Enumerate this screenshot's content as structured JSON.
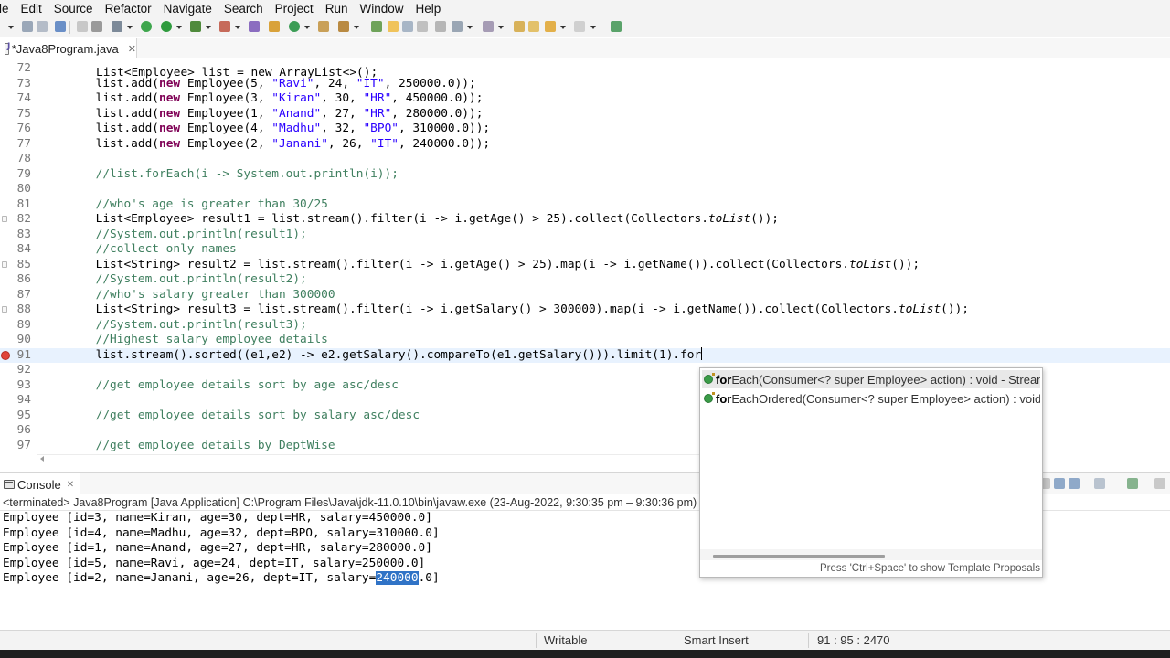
{
  "menu": [
    "le",
    "Edit",
    "Source",
    "Refactor",
    "Navigate",
    "Search",
    "Project",
    "Run",
    "Window",
    "Help"
  ],
  "editor": {
    "tab_title": "*Java8Program.java",
    "tab_close": "✕",
    "top_partial_text": "List<Employee> list = new ArrayList<>();",
    "lines": [
      {
        "num": "72",
        "text": ""
      },
      {
        "num": "73",
        "text": "        list.add(new Employee(5, \"Ravi\", 24, \"IT\", 250000.0));"
      },
      {
        "num": "74",
        "text": "        list.add(new Employee(3, \"Kiran\", 30, \"HR\", 450000.0));"
      },
      {
        "num": "75",
        "text": "        list.add(new Employee(1, \"Anand\", 27, \"HR\", 280000.0));"
      },
      {
        "num": "76",
        "text": "        list.add(new Employee(4, \"Madhu\", 32, \"BPO\", 310000.0));"
      },
      {
        "num": "77",
        "text": "        list.add(new Employee(2, \"Janani\", 26, \"IT\", 240000.0));"
      },
      {
        "num": "78",
        "text": ""
      },
      {
        "num": "79",
        "text": "        //list.forEach(i -> System.out.println(i));"
      },
      {
        "num": "80",
        "text": ""
      },
      {
        "num": "81",
        "text": "        //who's age is greater than 30/25"
      },
      {
        "num": "82",
        "text": "        List<Employee> result1 = list.stream().filter(i -> i.getAge() > 25).collect(Collectors.toList());"
      },
      {
        "num": "83",
        "text": "        //System.out.println(result1);"
      },
      {
        "num": "84",
        "text": "        //collect only names"
      },
      {
        "num": "85",
        "text": "        List<String> result2 = list.stream().filter(i -> i.getAge() > 25).map(i -> i.getName()).collect(Collectors.toList());"
      },
      {
        "num": "86",
        "text": "        //System.out.println(result2);"
      },
      {
        "num": "87",
        "text": "        //who's salary greater than 300000"
      },
      {
        "num": "88",
        "text": "        List<String> result3 = list.stream().filter(i -> i.getSalary() > 300000).map(i -> i.getName()).collect(Collectors.toList());"
      },
      {
        "num": "89",
        "text": "        //System.out.println(result3);"
      },
      {
        "num": "90",
        "text": "        //Highest salary employee details"
      },
      {
        "num": "91",
        "text": "        list.stream().sorted((e1,e2) -> e2.getSalary().compareTo(e1.getSalary())).limit(1).for"
      },
      {
        "num": "92",
        "text": ""
      },
      {
        "num": "93",
        "text": "        //get employee details sort by age asc/desc"
      },
      {
        "num": "94",
        "text": ""
      },
      {
        "num": "95",
        "text": "        //get employee details sort by salary asc/desc"
      },
      {
        "num": "96",
        "text": ""
      },
      {
        "num": "97",
        "text": "        //get employee details by DeptWise"
      }
    ]
  },
  "content_assist": {
    "items": [
      {
        "match": "for",
        "rest": "Each(Consumer<? super Employee> action) : void - Stream"
      },
      {
        "match": "for",
        "rest": "EachOrdered(Consumer<? super Employee> action) : void -"
      }
    ],
    "footer": "Press 'Ctrl+Space' to show Template Proposals"
  },
  "console": {
    "tab_title": "Console",
    "tab_close": "✕",
    "status": "<terminated> Java8Program [Java Application] C:\\Program Files\\Java\\jdk-11.0.10\\bin\\javaw.exe  (23-Aug-2022, 9:30:35 pm – 9:30:36 pm)",
    "lines": [
      "Employee [id=3, name=Kiran, age=30, dept=HR, salary=450000.0]",
      "Employee [id=4, name=Madhu, age=32, dept=BPO, salary=310000.0]",
      "Employee [id=1, name=Anand, age=27, dept=HR, salary=280000.0]",
      "Employee [id=5, name=Ravi, age=24, dept=IT, salary=250000.0]"
    ],
    "last_line_prefix": "Employee [id=2, name=Janani, age=26, dept=IT, salary=",
    "last_line_selected": "240000",
    "last_line_suffix": ".0]"
  },
  "statusbar": {
    "mode": "Writable",
    "insert": "Smart Insert",
    "position": "91 : 95 : 2470"
  }
}
